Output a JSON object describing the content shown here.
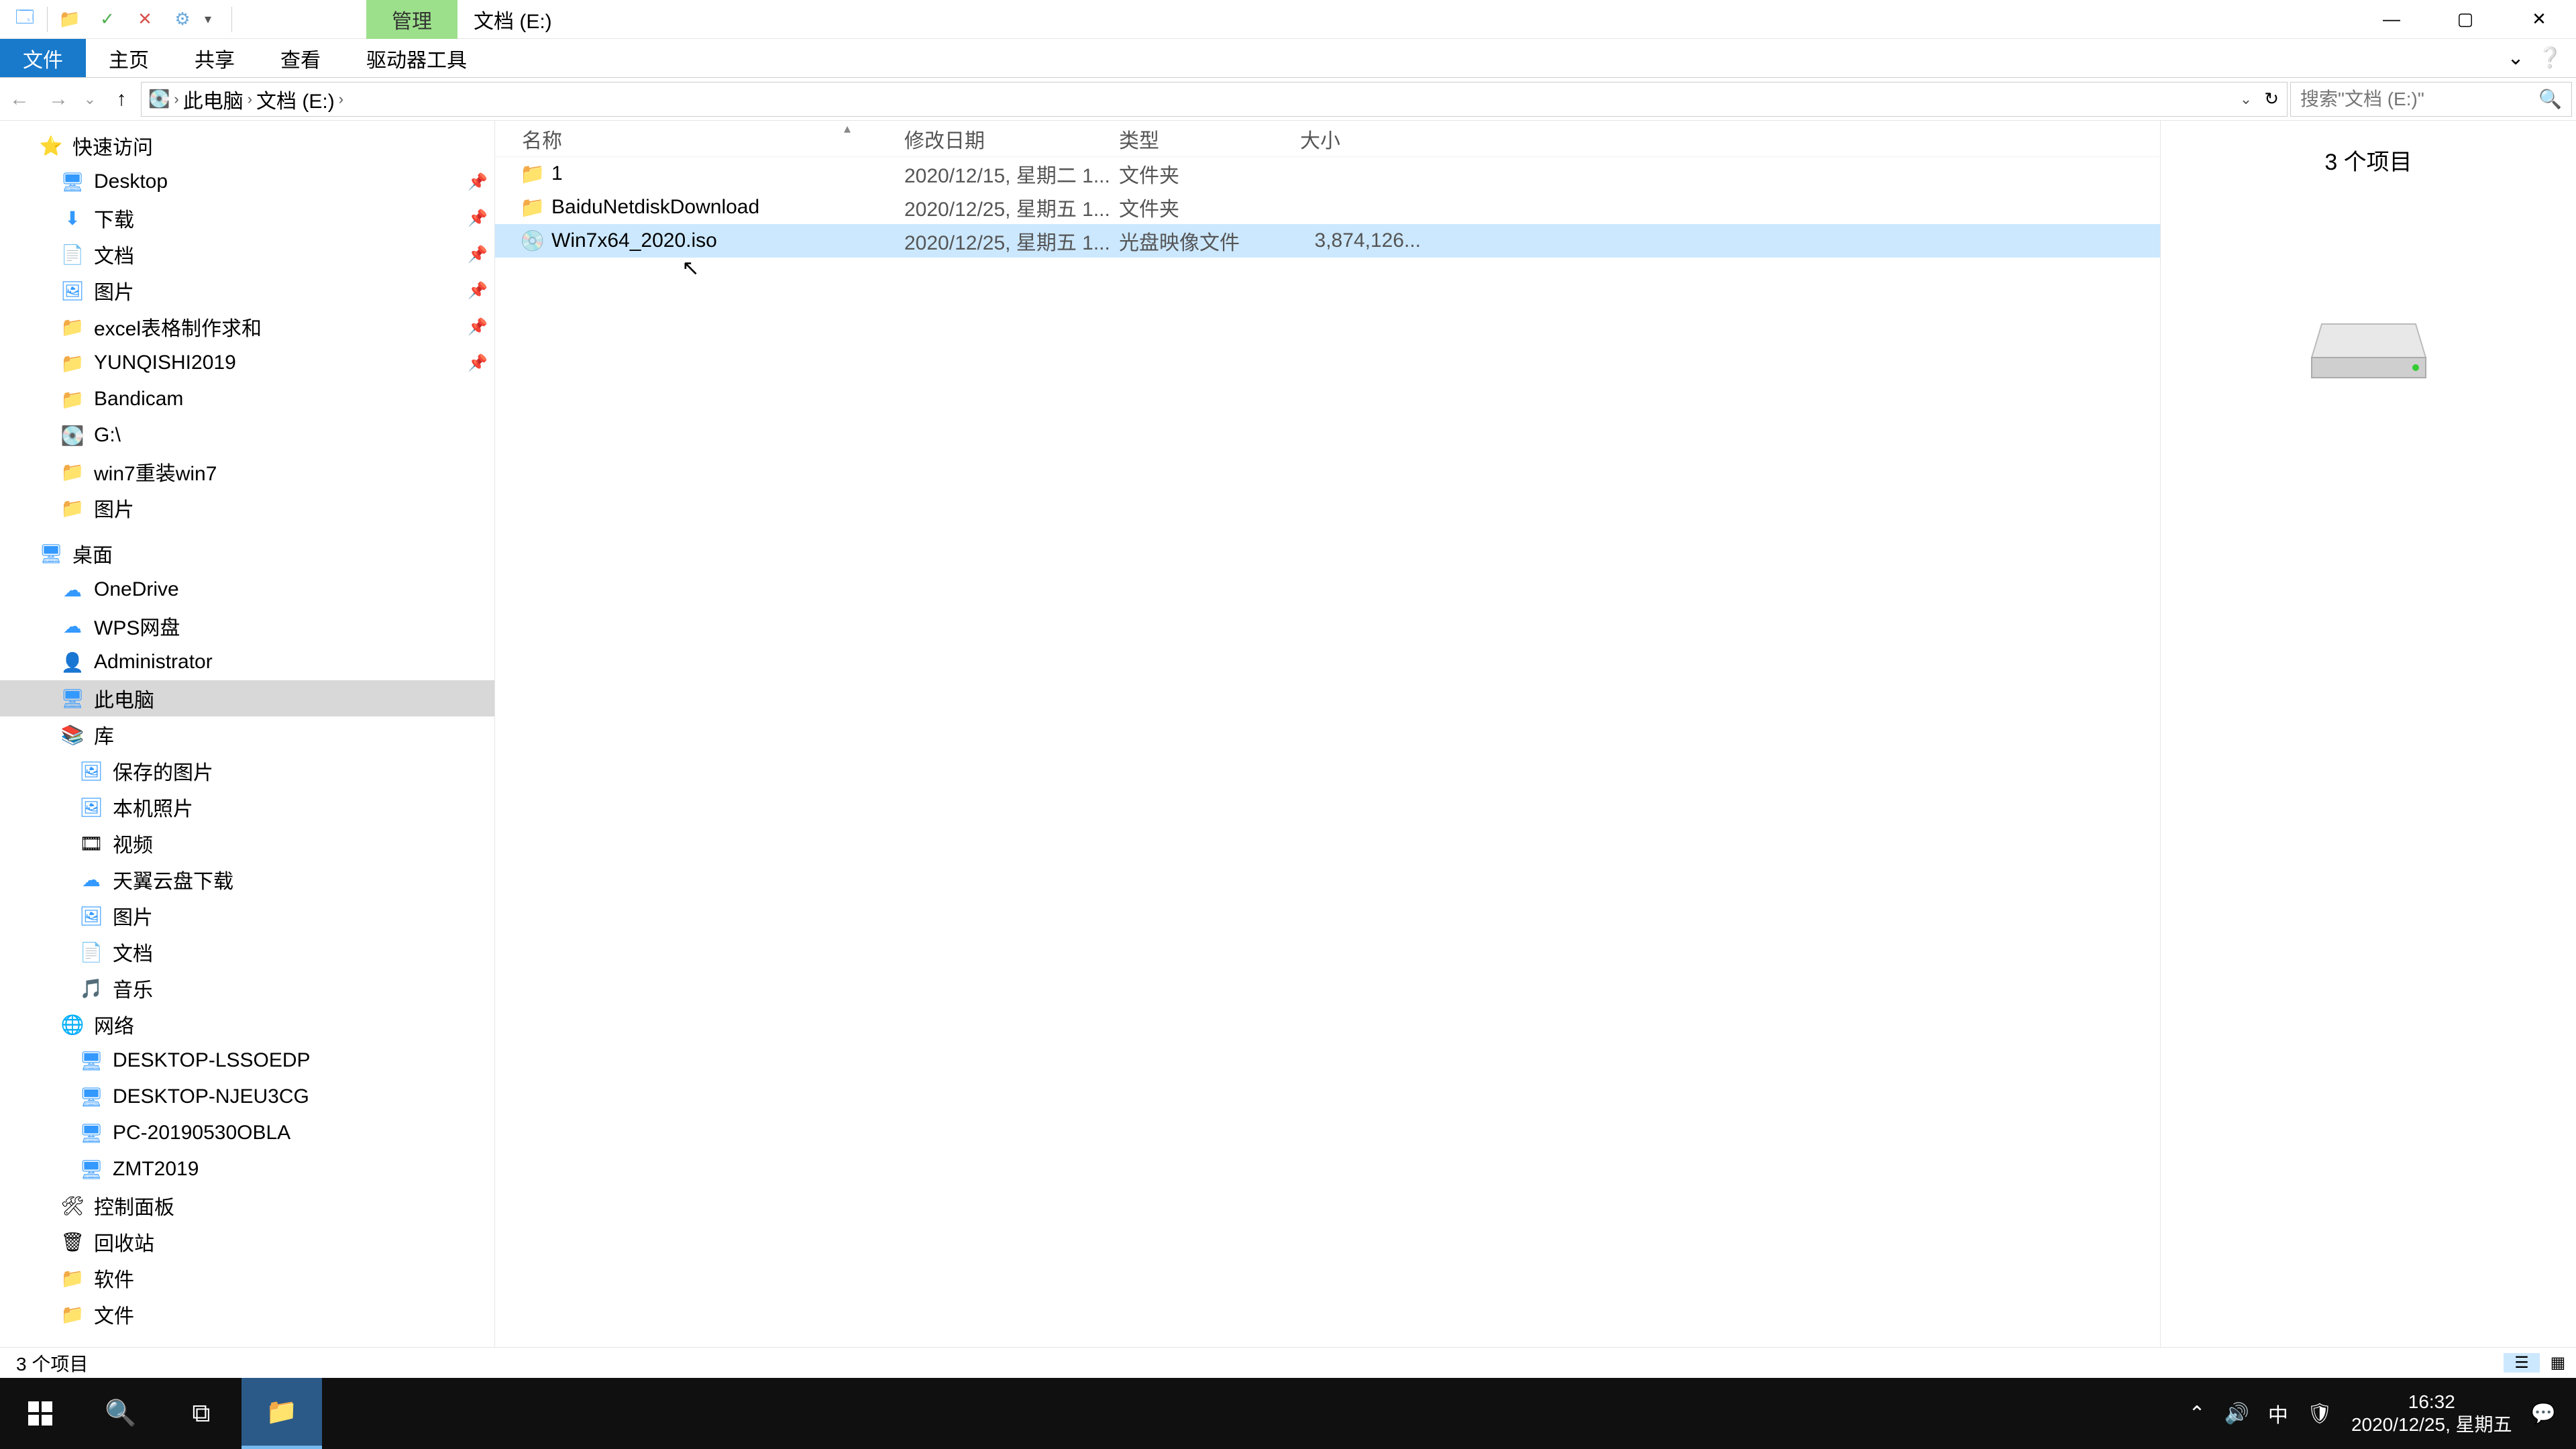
{
  "titlebar": {
    "context_tab": "管理",
    "title": "文档 (E:)"
  },
  "ribbon": {
    "file": "文件",
    "home": "主页",
    "share": "共享",
    "view": "查看",
    "drive_tools": "驱动器工具"
  },
  "address": {
    "root": "此电脑",
    "location": "文档 (E:)"
  },
  "search": {
    "placeholder": "搜索\"文档 (E:)\""
  },
  "nav": {
    "quick_access": "快速访问",
    "desktop": "Desktop",
    "downloads": "下载",
    "documents": "文档",
    "pictures": "图片",
    "excel": "excel表格制作求和",
    "yunqishi": "YUNQISHI2019",
    "bandicam": "Bandicam",
    "gdrive": "G:\\",
    "win7reinstall": "win7重装win7",
    "pictures2": "图片",
    "desktop2": "桌面",
    "onedrive": "OneDrive",
    "wps": "WPS网盘",
    "admin": "Administrator",
    "thispc": "此电脑",
    "library": "库",
    "saved_pics": "保存的图片",
    "local_photos": "本机照片",
    "videos": "视频",
    "tianyi": "天翼云盘下载",
    "pictures3": "图片",
    "documents2": "文档",
    "music": "音乐",
    "network": "网络",
    "pc1": "DESKTOP-LSSOEDP",
    "pc2": "DESKTOP-NJEU3CG",
    "pc3": "PC-20190530OBLA",
    "pc4": "ZMT2019",
    "control_panel": "控制面板",
    "recycle": "回收站",
    "software": "软件",
    "files": "文件"
  },
  "columns": {
    "name": "名称",
    "date": "修改日期",
    "type": "类型",
    "size": "大小"
  },
  "files": [
    {
      "icon": "folder",
      "name": "1",
      "date": "2020/12/15, 星期二 1...",
      "type": "文件夹",
      "size": "",
      "selected": false
    },
    {
      "icon": "folder",
      "name": "BaiduNetdiskDownload",
      "date": "2020/12/25, 星期五 1...",
      "type": "文件夹",
      "size": "",
      "selected": false
    },
    {
      "icon": "iso",
      "name": "Win7x64_2020.iso",
      "date": "2020/12/25, 星期五 1...",
      "type": "光盘映像文件",
      "size": "3,874,126...",
      "selected": true
    }
  ],
  "preview": {
    "summary": "3 个项目"
  },
  "status": {
    "count": "3 个项目"
  },
  "taskbar": {
    "time": "16:32",
    "date": "2020/12/25, 星期五",
    "ime": "中"
  }
}
